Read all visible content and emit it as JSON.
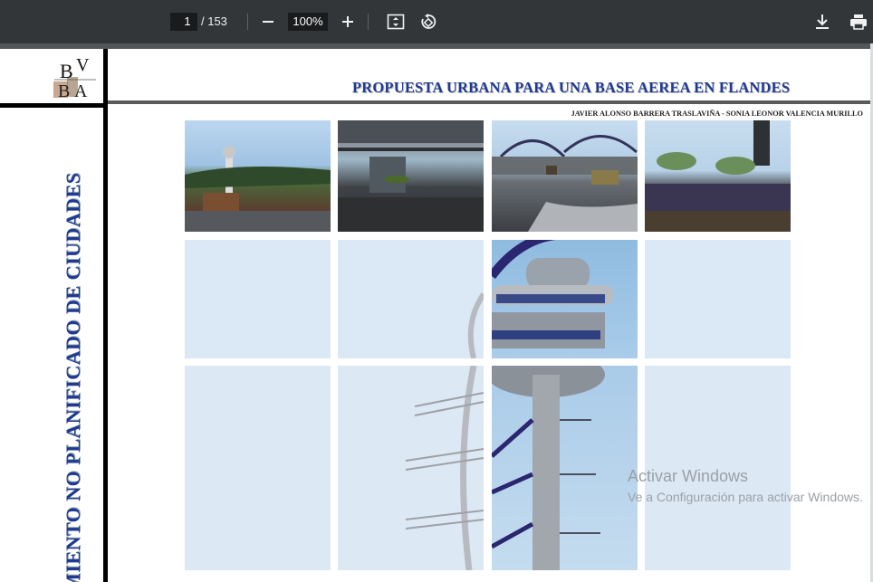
{
  "toolbar": {
    "page_current": "1",
    "page_total": "/ 153",
    "zoom": "100%",
    "icons": [
      "minus-icon",
      "plus-icon",
      "fit-page-icon",
      "rotate-icon",
      "download-icon",
      "print-icon"
    ]
  },
  "document": {
    "logo_text": "BV BA",
    "title": "PROPUESTA URBANA PARA UNA BASE AEREA EN FLANDES",
    "authors": "JAVIER ALONSO BARRERA TRASLAVIÑA - SONIA LEONOR VALENCIA MURILLO",
    "vertical_text": "MIENTO NO PLANIFICADO DE CIUDADES",
    "images": [
      {
        "label": "render-control-tower-aerial"
      },
      {
        "label": "render-hangar-helicopter"
      },
      {
        "label": "render-arches-truck"
      },
      {
        "label": "render-buildings-trees"
      }
    ]
  },
  "watermark": {
    "line1": "Activar Windows",
    "line2": "Ve a Configuración para activar Windows."
  },
  "colors": {
    "toolbar_bg": "#323639",
    "title_blue": "#1f3a93",
    "viewer_bg": "#525659"
  }
}
